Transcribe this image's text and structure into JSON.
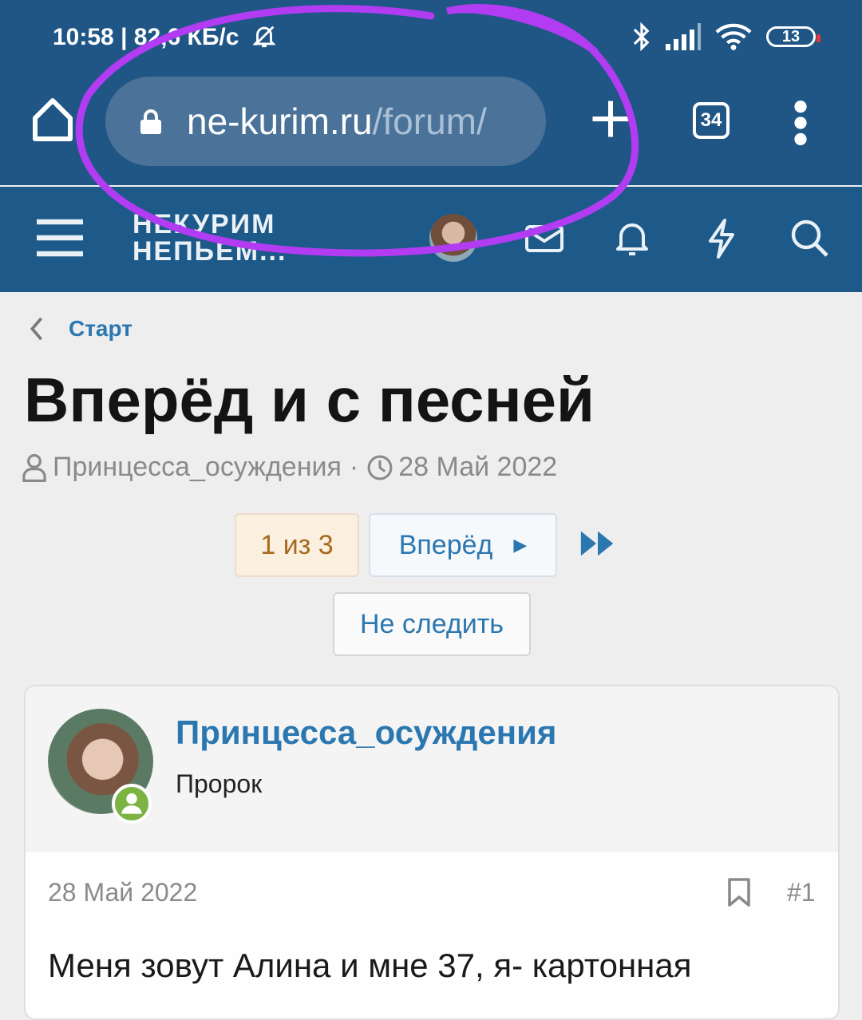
{
  "status_bar": {
    "left_text": "10:58 | 82,6 КБ/с",
    "battery_level": "13"
  },
  "browser": {
    "url_host": "ne-kurim.ru",
    "url_path": "/forum/",
    "tab_count": "34"
  },
  "site_header": {
    "logo_line1": "НЕКУРИМ",
    "logo_line2": "НЕПЬЕМ..."
  },
  "breadcrumb": {
    "label": "Старт"
  },
  "thread": {
    "title": "Вперёд и с песней",
    "author": "Принцесса_осуждения",
    "date": "28 Май 2022"
  },
  "pagination": {
    "current": "1 из 3",
    "next_label": "Вперёд",
    "unwatch_label": "Не следить"
  },
  "post": {
    "username": "Принцесса_осуждения",
    "role": "Пророк",
    "date": "28 Май 2022",
    "number": "#1",
    "text": "Меня зовут Алина и мне 37, я- картонная"
  },
  "colors": {
    "header_bg": "#1f5686",
    "link": "#2b77b0",
    "annotation": "#b13cf2",
    "online": "#7cb342"
  }
}
